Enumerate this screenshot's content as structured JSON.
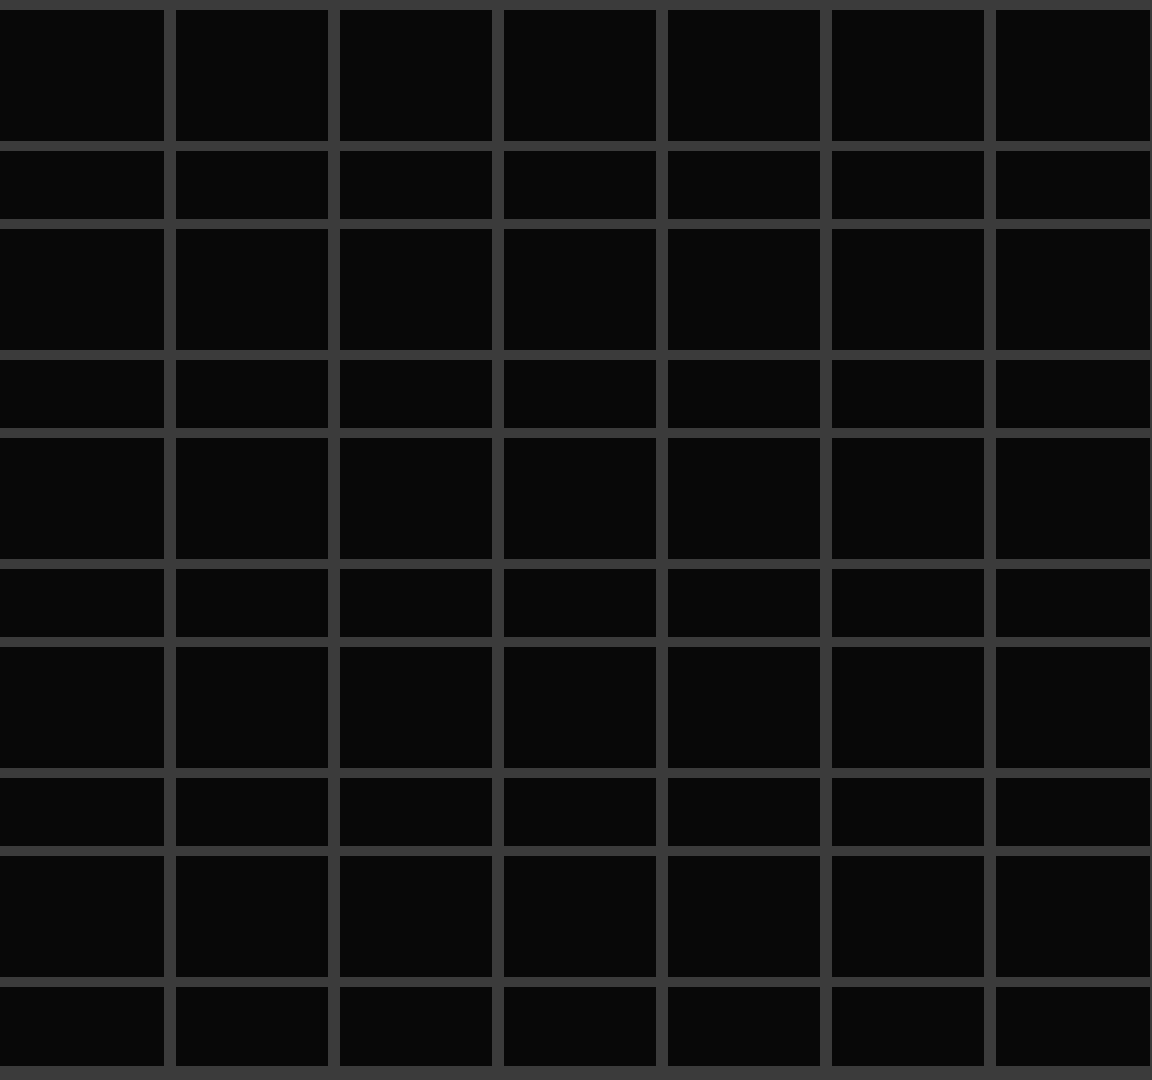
{
  "grid": {
    "columns": 7,
    "rows": 10,
    "cell_color": "#080808",
    "line_color": "#3b3b3b"
  }
}
